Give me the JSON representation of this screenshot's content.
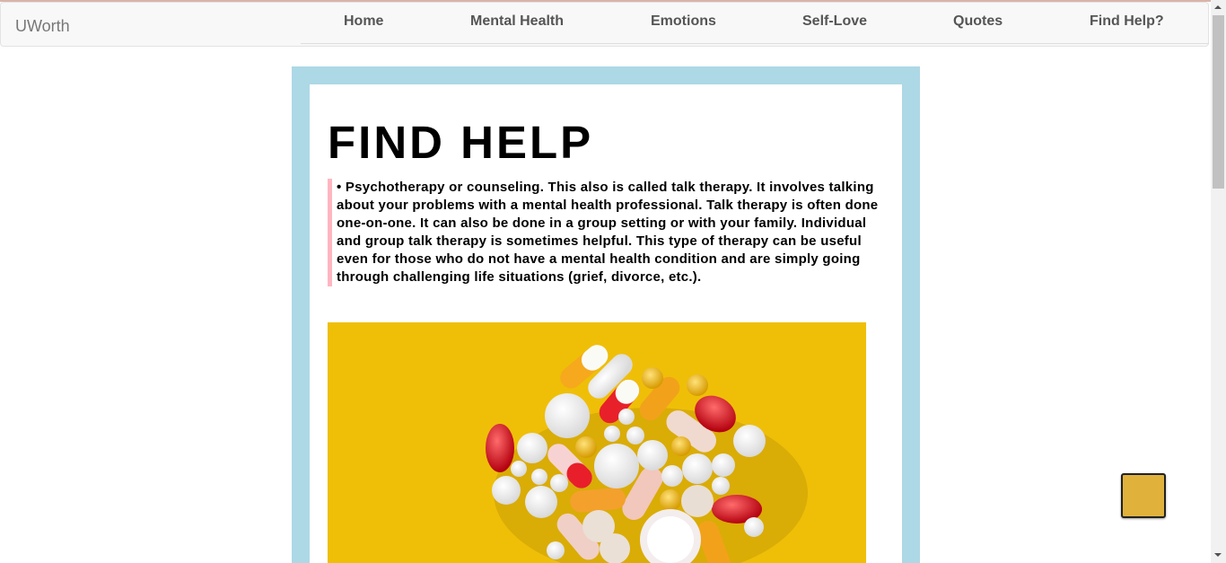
{
  "nav": {
    "brand": "UWorth",
    "items": [
      {
        "label": "Home",
        "icon": "home-icon",
        "glyph": ""
      },
      {
        "label": "Mental Health",
        "icon": "brain-icon",
        "glyph": ""
      },
      {
        "label": "Emotions",
        "icon": "smile-icon",
        "glyph": ""
      },
      {
        "label": "Self-Love",
        "icon": "heart-icon",
        "glyph": ""
      },
      {
        "label": "Quotes",
        "icon": "quote-icon",
        "glyph": ""
      },
      {
        "label": "Find Help?",
        "icon": "question-icon",
        "glyph": ""
      }
    ]
  },
  "main": {
    "title": "FIND HELP",
    "paragraph": "• Psychotherapy or counseling. This also is called talk therapy. It involves talking about your problems with a mental health professional. Talk therapy is often done one-on-one. It can also be done in a group setting or with your family. Individual and group talk therapy is sometimes helpful. This type of therapy can be useful even for those who do not have a mental health condition and are simply going through challenging life situations (grief, divorce, etc.).",
    "image_subject": "pills-image"
  },
  "back_to_top": {
    "icon": "arrow-up-icon",
    "glyph": ""
  },
  "colors": {
    "frame": "#add8e6",
    "quote_border": "#ffb6c1",
    "image_background": "#efbf08",
    "back_to_top": "#e0b23c"
  }
}
